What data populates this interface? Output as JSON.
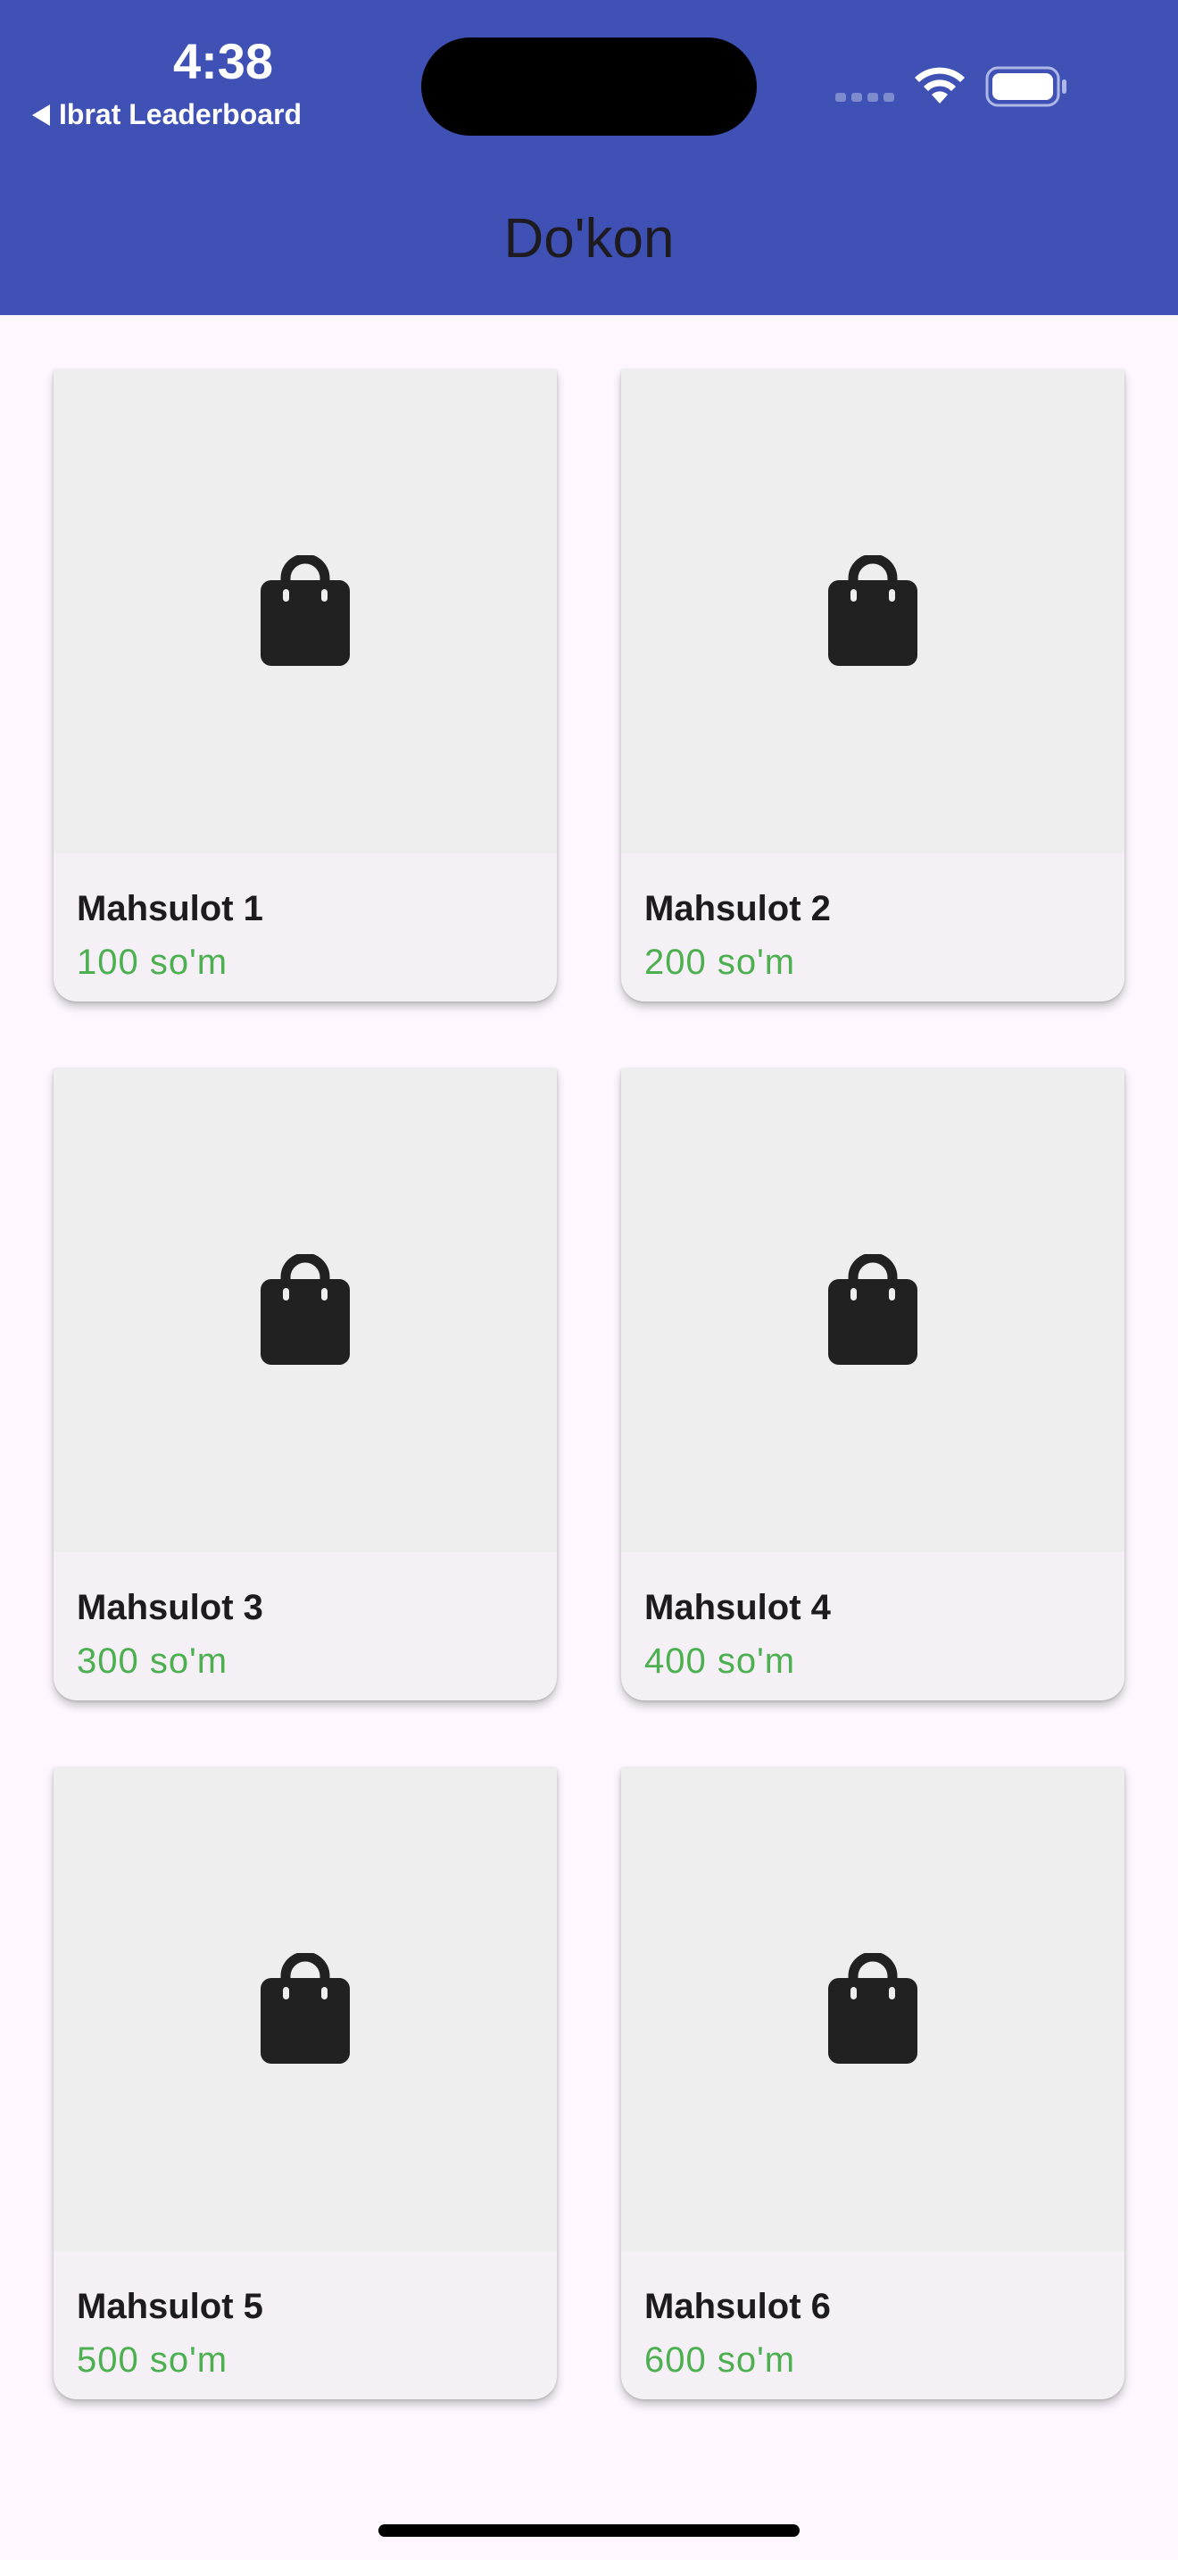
{
  "status_bar": {
    "time": "4:38",
    "back_label": "Ibrat Leaderboard"
  },
  "app_bar": {
    "title": "Do'kon",
    "color": "#3F51B5"
  },
  "products": [
    {
      "name": "Mahsulot 1",
      "price": "100 so'm",
      "icon": "shopping-bag-icon"
    },
    {
      "name": "Mahsulot 2",
      "price": "200 so'm",
      "icon": "shopping-bag-icon"
    },
    {
      "name": "Mahsulot 3",
      "price": "300 so'm",
      "icon": "shopping-bag-icon"
    },
    {
      "name": "Mahsulot 4",
      "price": "400 so'm",
      "icon": "shopping-bag-icon"
    },
    {
      "name": "Mahsulot 5",
      "price": "500 so'm",
      "icon": "shopping-bag-icon"
    },
    {
      "name": "Mahsulot 6",
      "price": "600 so'm",
      "icon": "shopping-bag-icon"
    }
  ],
  "colors": {
    "price": "#4CAF50",
    "background": "#FEF7FF"
  }
}
